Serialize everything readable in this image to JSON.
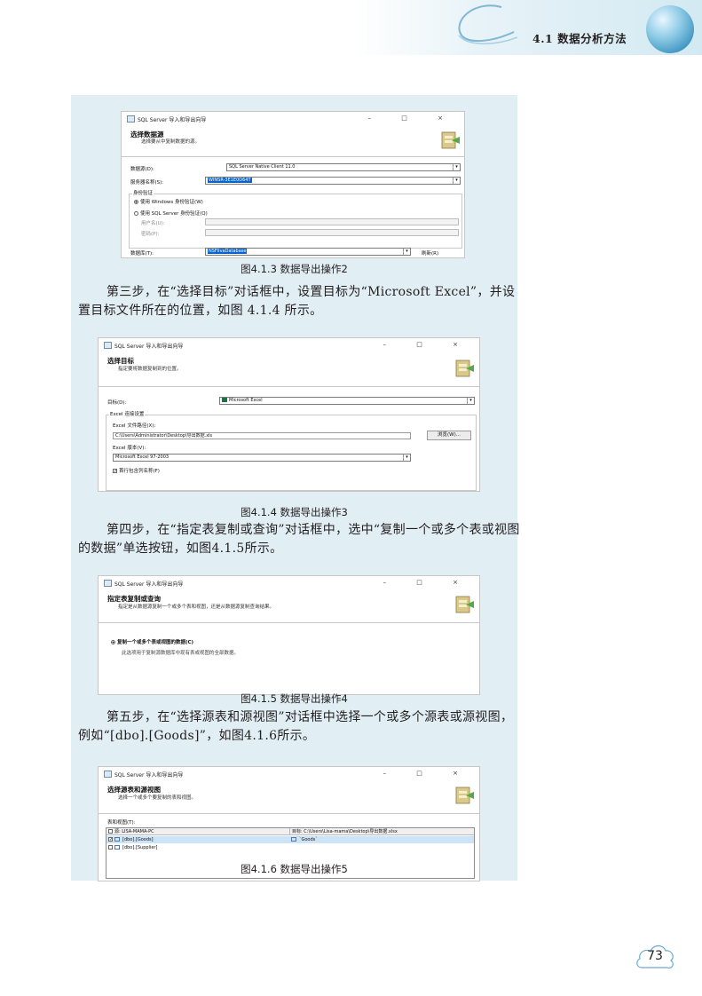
{
  "header": {
    "section_title": "4.1  数据分析方法"
  },
  "window_title": "SQL Server 导入和导出向导",
  "window_controls": "–  □  ×",
  "fig1": {
    "heading": "选择数据源",
    "subheading": "选择要从中复制数据的源。",
    "datasource_label": "数据源(D):",
    "datasource_value": "SQL Server Native Client 11.0",
    "server_label": "服务器名称(S):",
    "server_value": "WINSR-3E1E0D64T",
    "auth_group": "身份验证",
    "win_auth": "使用 Windows 身份验证(W)",
    "sql_auth": "使用 SQL Server 身份验证(Q)",
    "user_label": "用户名(U):",
    "pwd_label": "密码(P):",
    "db_label": "数据库(T):",
    "db_value": "NSFlivaDatabase",
    "refresh": "刷新(R)",
    "caption": "图4.1.3  数据导出操作2"
  },
  "para1": "第三步，在“选择目标”对话框中，设置目标为“Microsoft Excel”，并设置目标文件所在的位置，如图 4.1.4 所示。",
  "fig2": {
    "heading": "选择目标",
    "subheading": "指定要将数据复制到的位置。",
    "target_label": "目标(D):",
    "target_value": "Microsoft Excel",
    "group_label": "Excel 连接设置",
    "path_label": "Excel 文件路径(X):",
    "path_value": "C:\\Users\\Administrator\\Desktop\\导出数据.xls",
    "browse": "浏览(W)...",
    "version_label": "Excel 版本(V):",
    "version_value": "Microsoft Excel 97-2003",
    "first_row": "首行包含列名称(F)",
    "caption": "图4.1.4  数据导出操作3"
  },
  "para2": "第四步，在“指定表复制或查询”对话框中，选中“复制一个或多个表或视图的数据”单选按钮，如图4.1.5所示。",
  "fig3": {
    "heading": "指定表复制或查询",
    "subheading": "指定是从数据源复制一个或多个表和视图，还是从数据源复制查询结果。",
    "option": "复制一个或多个表或视图的数据(C)",
    "option_desc": "此选项用于复制源数据库中现有表或视图的全部数据。",
    "caption": "图4.1.5  数据导出操作4"
  },
  "para3": "第五步，在“选择源表和源视图”对话框中选择一个或多个源表或源视图，例如“[dbo].[Goods]”，如图4.1.6所示。",
  "fig4": {
    "heading": "选择源表和源视图",
    "subheading": "选择一个或多个要复制的表和视图。",
    "list_label": "表和视图(T):",
    "col_source": "源: LISA-MAMA-PC",
    "col_dest": "目标: C:\\Users\\Lisa-mama\\Desktop\\导出数据.xlsx",
    "rows": [
      {
        "source": "[dbo].[Goods]",
        "dest": "`Goods`"
      },
      {
        "source": "[dbo].[Supplier]",
        "dest": ""
      }
    ],
    "caption": "图4.1.6  数据导出操作5"
  },
  "page_number": "73",
  "colors": {
    "panel": "#e1eef4",
    "selection": "#0a64c8",
    "header_ball": "#3d93c0"
  }
}
